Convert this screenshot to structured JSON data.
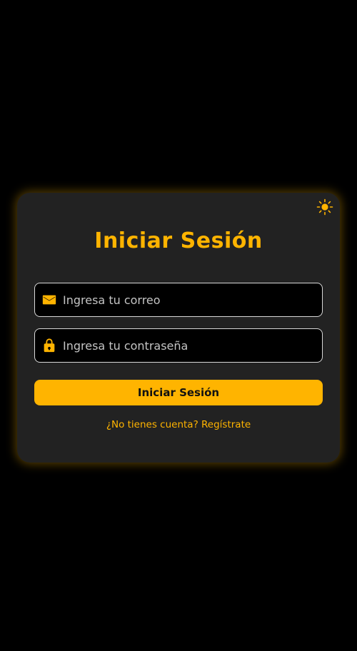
{
  "colors": {
    "accent": "#FFB400",
    "background": "#000000",
    "card": "#222222",
    "input_background": "#000000",
    "input_border": "#D9D9D9",
    "button_text": "#111111"
  },
  "theme_toggle": {
    "icon": "sun-icon"
  },
  "login": {
    "title": "Iniciar Sesión",
    "email": {
      "icon": "mail-icon",
      "placeholder": "Ingresa tu correo",
      "value": ""
    },
    "password": {
      "icon": "lock-icon",
      "placeholder": "Ingresa tu contraseña",
      "value": ""
    },
    "submit_label": "Iniciar Sesión",
    "register_link": "¿No tienes cuenta? Regístrate"
  }
}
